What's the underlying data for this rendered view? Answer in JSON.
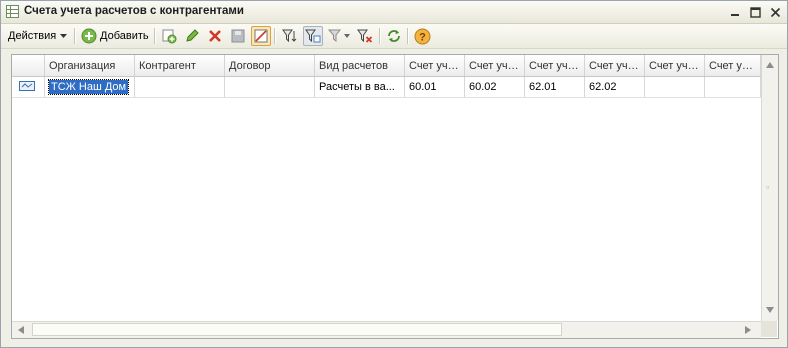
{
  "window": {
    "title": "Счета учета расчетов с контрагентами"
  },
  "toolbar": {
    "actions_label": "Действия",
    "add_label_first": "Д",
    "add_label_rest": "обавить"
  },
  "table": {
    "columns": [
      "Организация",
      "Контрагент",
      "Договор",
      "Вид расчетов",
      "Счет уче...",
      "Счет уче...",
      "Счет уче...",
      "Счет уче...",
      "Счет уче...",
      "Счет уче..."
    ],
    "rows": [
      [
        "ТСЖ Наш Дом",
        "",
        "",
        "Расчеты в ва...",
        "60.01",
        "60.02",
        "62.01",
        "62.02",
        "",
        ""
      ]
    ]
  },
  "colors": {
    "selection": "#2f6cc4",
    "window_bg": "#f0efe5"
  }
}
